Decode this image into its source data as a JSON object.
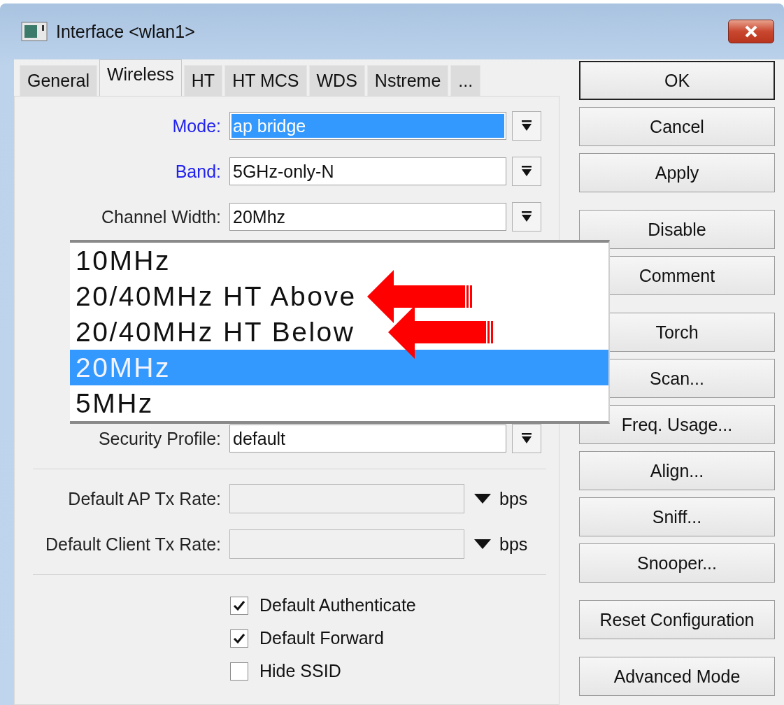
{
  "window": {
    "title": "Interface <wlan1>"
  },
  "tabs": [
    {
      "label": "General",
      "selected": false
    },
    {
      "label": "Wireless",
      "selected": true
    },
    {
      "label": "HT",
      "selected": false
    },
    {
      "label": "HT MCS",
      "selected": false
    },
    {
      "label": "WDS",
      "selected": false
    },
    {
      "label": "Nstreme",
      "selected": false
    },
    {
      "label": "...",
      "selected": false
    }
  ],
  "fields": [
    {
      "label": "Mode:",
      "highlighted": true,
      "value": "ap bridge",
      "value_selected": true
    },
    {
      "label": "Band:",
      "highlighted": true,
      "value": "5GHz-only-N",
      "value_selected": false
    },
    {
      "label": "Channel Width:",
      "highlighted": false,
      "value": "20Mhz",
      "value_selected": false
    }
  ],
  "security_field": {
    "label": "Security Profile:",
    "value": "default"
  },
  "rate_fields": [
    {
      "label": "Default AP Tx Rate:",
      "unit": "bps"
    },
    {
      "label": "Default Client Tx Rate:",
      "unit": "bps"
    }
  ],
  "checkboxes": [
    {
      "label": "Default Authenticate",
      "checked": true
    },
    {
      "label": "Default Forward",
      "checked": true
    },
    {
      "label": "Hide SSID",
      "checked": false
    }
  ],
  "dropdown": {
    "items": [
      {
        "label": "10MHz",
        "selected": false,
        "marked": false
      },
      {
        "label": "20/40MHz HT Above",
        "selected": false,
        "marked": true
      },
      {
        "label": "20/40MHz HT Below",
        "selected": false,
        "marked": true
      },
      {
        "label": "20MHz",
        "selected": true,
        "marked": false
      },
      {
        "label": "5MHz",
        "selected": false,
        "marked": false
      }
    ]
  },
  "button_groups": [
    {
      "buttons": [
        {
          "label": "OK",
          "default": true
        },
        {
          "label": "Cancel",
          "default": false
        },
        {
          "label": "Apply",
          "default": false
        }
      ]
    },
    {
      "buttons": [
        {
          "label": "Disable",
          "default": false
        },
        {
          "label": "Comment",
          "default": false
        }
      ]
    },
    {
      "buttons": [
        {
          "label": "Torch",
          "default": false
        },
        {
          "label": "Scan...",
          "default": false
        },
        {
          "label": "Freq. Usage...",
          "default": false
        },
        {
          "label": "Align...",
          "default": false
        },
        {
          "label": "Sniff...",
          "default": false
        },
        {
          "label": "Snooper...",
          "default": false
        }
      ]
    },
    {
      "buttons": [
        {
          "label": "Reset Configuration",
          "default": false
        }
      ]
    },
    {
      "buttons": [
        {
          "label": "Advanced Mode",
          "default": false
        }
      ]
    }
  ]
}
